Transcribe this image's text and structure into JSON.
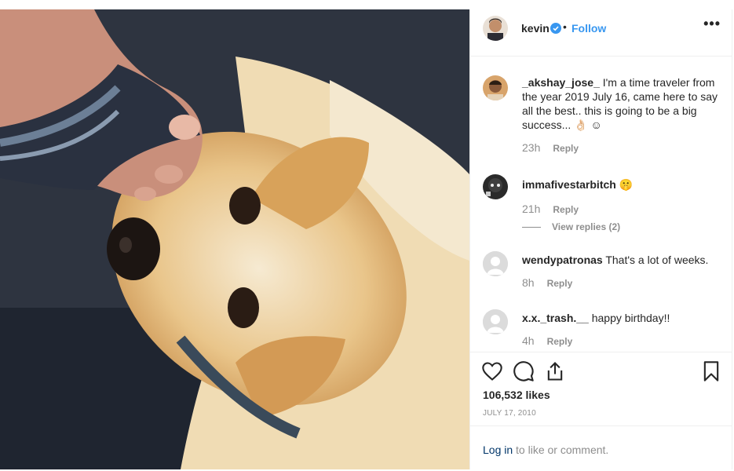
{
  "post": {
    "username": "kevin",
    "follow_label": "Follow",
    "separator": "•",
    "more_label": "•••",
    "likes": "106,532 likes",
    "date": "JULY 17, 2010",
    "login_link": "Log in",
    "login_suffix": " to like or comment."
  },
  "comments": [
    {
      "user": "_akshay_jose_",
      "text": " I'm a time traveler from the year 2019 July 16, came here to say all the best.. this is going to be a big success... 👌🏻 ☺",
      "time": "23h",
      "reply": "Reply"
    },
    {
      "user": "immafivestarbitch",
      "text": " 🤫",
      "time": "21h",
      "reply": "Reply",
      "view_replies": "View replies (2)"
    },
    {
      "user": "wendypatronas",
      "text": " That's a lot of weeks.",
      "time": "8h",
      "reply": "Reply"
    },
    {
      "user": "x.x._trash.__",
      "text": " happy birthday!!",
      "time": "4h",
      "reply": "Reply"
    }
  ],
  "colors": {
    "accent": "#3897f0",
    "muted": "#8e8e8e",
    "link": "#003569"
  },
  "icons": [
    "verified-badge-icon",
    "more-options-icon",
    "heart-icon",
    "comment-icon",
    "share-icon",
    "bookmark-icon"
  ]
}
